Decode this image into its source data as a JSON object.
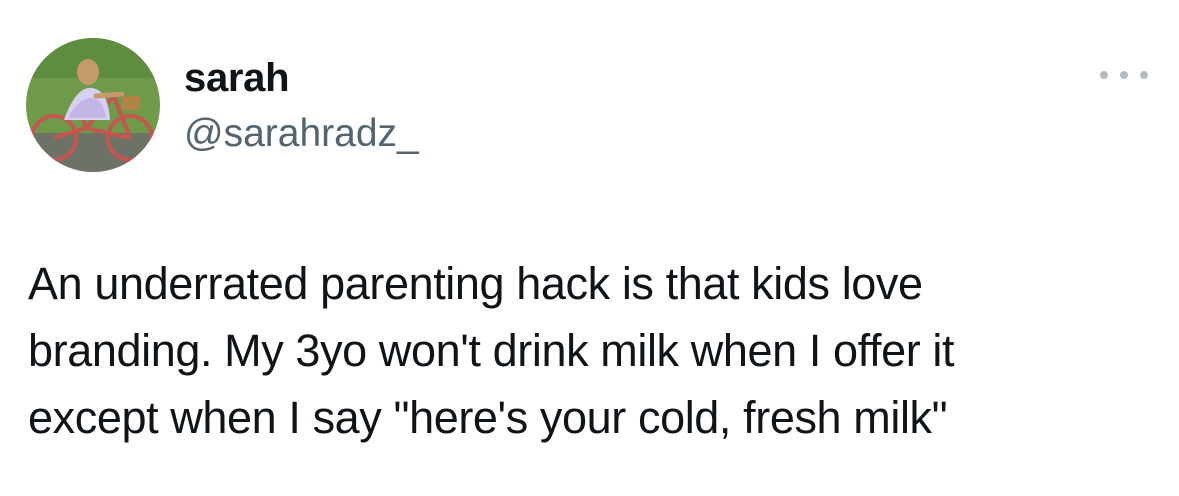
{
  "author": {
    "display_name": "sarah",
    "handle": "@sarahradz_"
  },
  "tweet": {
    "text": "An underrated parenting hack is that kids love\nbranding. My 3yo won't drink milk when I offer it\nexcept when I say \"here's your cold, fresh milk\""
  },
  "icons": {
    "more": "more-options-icon",
    "avatar": "profile-photo"
  },
  "colors": {
    "text_primary": "#0f1419",
    "text_secondary": "#536471",
    "more_dots": "#b3bac0",
    "background": "#ffffff"
  }
}
